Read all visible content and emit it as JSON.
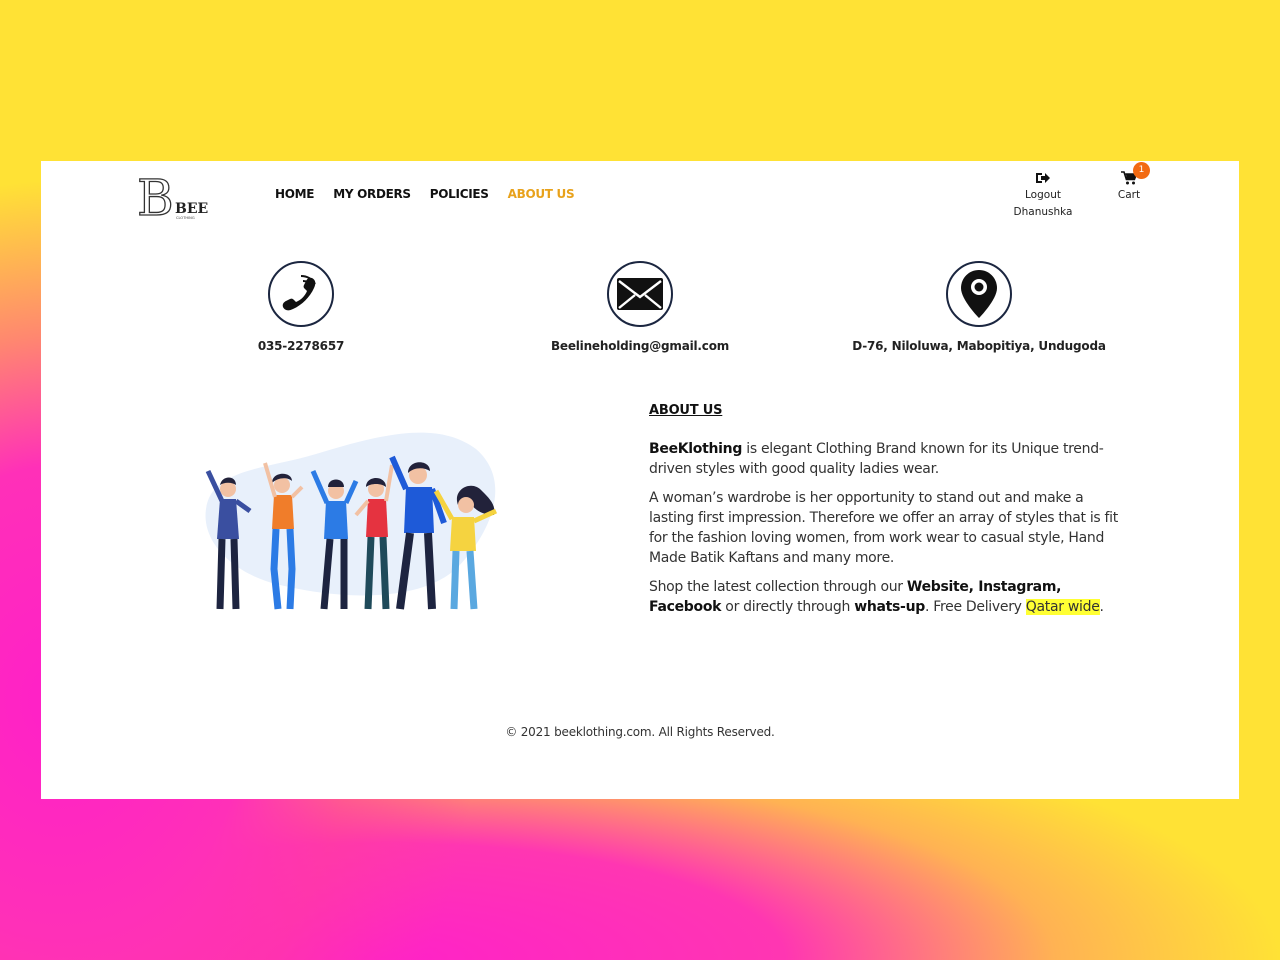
{
  "brand": {
    "logo_letter": "B",
    "logo_name": "BEE",
    "logo_sub": "CLOTHING"
  },
  "nav": [
    {
      "label": "HOME"
    },
    {
      "label": "MY ORDERS"
    },
    {
      "label": "POLICIES"
    },
    {
      "label": "ABOUT US",
      "active": true
    }
  ],
  "user": {
    "logout_label": "Logout",
    "username": "Dhanushka",
    "icon": "logout-icon"
  },
  "cart": {
    "label": "Cart",
    "count": "1",
    "icon": "cart-icon"
  },
  "contacts": {
    "phone": {
      "icon": "phone-icon",
      "text": "035-2278657"
    },
    "email": {
      "icon": "envelope-icon",
      "text": "Beelineholding@gmail.com"
    },
    "address": {
      "icon": "map-pin-icon",
      "text": "D-76, Niloluwa, Mabopitiya, Undugoda"
    }
  },
  "about": {
    "heading": "ABOUT US",
    "p1_brand": "BeeKlothing",
    "p1_rest": " is elegant Clothing Brand known for its Unique trend-driven styles with good quality ladies wear.",
    "p2": "A woman’s wardrobe is her opportunity to stand out and make a lasting first impression. Therefore we offer an array of styles that is fit for the fashion loving women, from work wear to casual style, Hand Made Batik Kaftans and many more.",
    "p3_a": "Shop the latest collection through our ",
    "p3_b": "Website, Instagram, Facebook",
    "p3_c": " or directly through ",
    "p3_d": "whats-up",
    "p3_e": ". Free Delivery ",
    "p3_f": "Qatar wide",
    "p3_g": "."
  },
  "footer": {
    "text": "© 2021 beeklothing.com. All Rights Reserved."
  },
  "colors": {
    "accent": "#e8a21c",
    "badge": "#f26a12",
    "highlight": "#ffff33",
    "backdrop_yellow": "#ffe235",
    "backdrop_pink": "#ff22c8"
  }
}
